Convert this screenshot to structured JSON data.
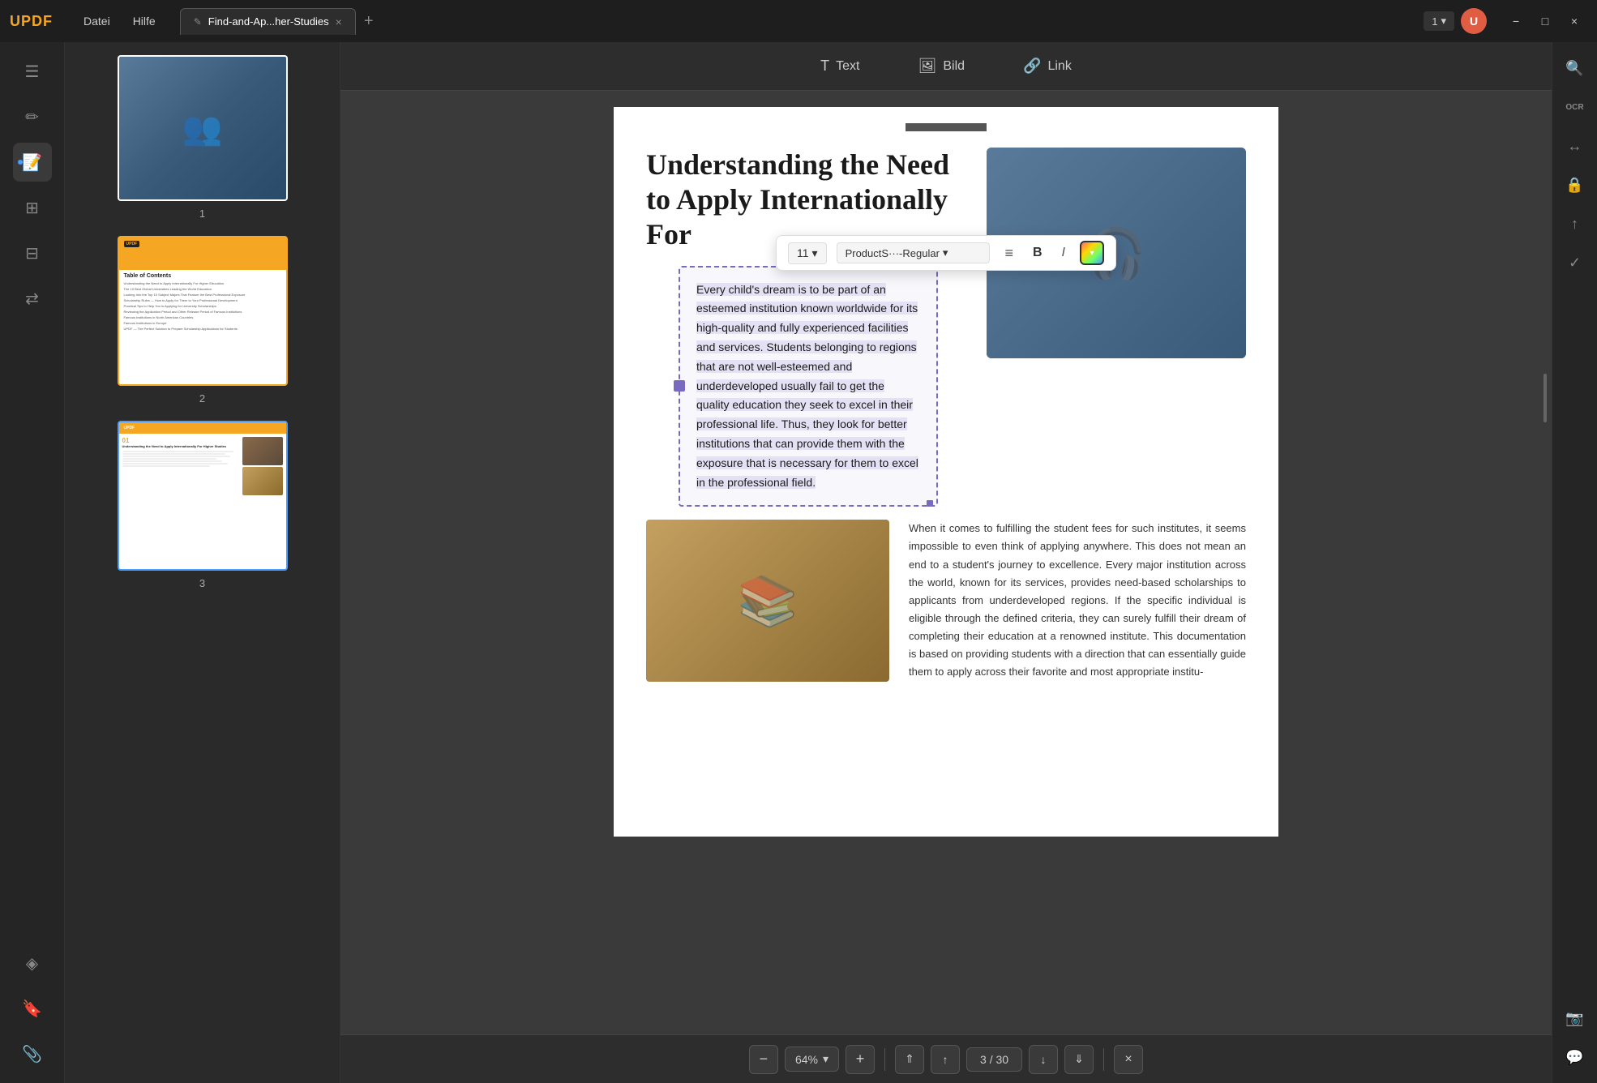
{
  "app": {
    "logo": "UPDF",
    "menus": [
      "Datei",
      "Hilfe"
    ],
    "tab": {
      "icon": "edit-icon",
      "label": "Find-and-Ap...her-Studies",
      "close": "×"
    },
    "new_tab": "+",
    "page_indicator": "1",
    "page_indicator_chevron": "▾",
    "window_controls": [
      "−",
      "□",
      "×"
    ]
  },
  "sidebar": {
    "icons": [
      {
        "name": "document-icon",
        "symbol": "☰",
        "active": false
      },
      {
        "name": "edit-icon",
        "symbol": "✏",
        "active": false
      },
      {
        "name": "annotate-icon",
        "symbol": "📝",
        "active": true
      },
      {
        "name": "pages-icon",
        "symbol": "⊞",
        "active": false
      },
      {
        "name": "organize-icon",
        "symbol": "⊟",
        "active": false
      },
      {
        "name": "convert-icon",
        "symbol": "⇄",
        "active": false
      },
      {
        "name": "layers-icon",
        "symbol": "◈",
        "active": false
      },
      {
        "name": "bookmark-icon",
        "symbol": "🔖",
        "active": false
      },
      {
        "name": "attachment-icon",
        "symbol": "📎",
        "active": false
      }
    ]
  },
  "thumbnails": [
    {
      "page_num": "1",
      "selected": false
    },
    {
      "page_num": "2",
      "selected": false,
      "label": "Table of Contents"
    },
    {
      "page_num": "3",
      "selected": true
    }
  ],
  "toolbar": {
    "text_label": "Text",
    "bild_label": "Bild",
    "link_label": "Link"
  },
  "format_toolbar": {
    "font_size": "11",
    "font_size_chevron": "▾",
    "font_name": "ProductS···-Regular",
    "font_name_chevron": "▾",
    "align_icon": "≡",
    "bold_label": "B",
    "italic_label": "I"
  },
  "document": {
    "page_title": "Understanding the Need to Apply Internationally For",
    "selected_paragraph": "Every child's dream is to be part of an esteemed institution known worldwide for its high-quality and fully experienced facilities and services. Students belonging to regions that are not well-esteemed and underdeveloped usually fail to get the quality education they seek to excel in their professional life. Thus, they look for better institutions that can provide them with the exposure that is necessary for them to excel in the professional field.",
    "right_paragraph": "When it comes to fulfilling the student fees for such institutes, it seems impossible to even think of applying anywhere. This does not mean an end to a student's journey to excellence. Every major institution across the world, known for its services, provides need-based scholarships to applicants from underdeveloped regions. If the specific individual is eligible through the defined criteria, they can surely fulfill their dream of completing their education at a renowned institute. This documentation is based on providing students with a direction that can essentially guide them to apply across their favorite and most appropriate institu-"
  },
  "bottom_bar": {
    "zoom_out": "−",
    "zoom_level": "64%",
    "zoom_chevron": "▾",
    "zoom_in": "+",
    "nav_top": "⇑",
    "nav_prev": "↑",
    "page_current": "3",
    "page_separator": "/",
    "page_total": "30",
    "nav_next": "↓",
    "nav_bottom": "⇓",
    "close": "×"
  },
  "right_sidebar": {
    "icons": [
      {
        "name": "search-icon",
        "symbol": "🔍"
      },
      {
        "name": "ocr-icon",
        "symbol": "OCR"
      },
      {
        "name": "convert-doc-icon",
        "symbol": "↔"
      },
      {
        "name": "lock-icon",
        "symbol": "🔒"
      },
      {
        "name": "share-icon",
        "symbol": "↑"
      },
      {
        "name": "check-icon",
        "symbol": "✓"
      },
      {
        "name": "camera-icon",
        "symbol": "📷"
      },
      {
        "name": "chat-icon",
        "symbol": "💬"
      }
    ]
  },
  "toc_items": [
    {
      "text": "Understanding the Need to Apply Internationally For Higher Education",
      "num": "01"
    },
    {
      "text": "The 10 Best Global Universities Leading the World Education",
      "num": ""
    },
    {
      "text": "Looking Into the Top 10 Subject Majors That Feature the Best Professional Exposure",
      "num": ""
    },
    {
      "text": "Scholarship Rules — How to Apply for Them to Your Professional Development",
      "num": ""
    },
    {
      "text": "Practical Tips to Help You in Applying for University Scholarships",
      "num": ""
    },
    {
      "text": "Reviewing the Application Period and Other Release Period of Famous Institutions",
      "num": ""
    },
    {
      "text": "Famous Institutions in North American Countries",
      "num": ""
    },
    {
      "text": "Famous Institutions in Europe",
      "num": ""
    },
    {
      "text": "UPDF — The Perfect Solution to Prepare Scholarship Applications for Students",
      "num": ""
    }
  ]
}
